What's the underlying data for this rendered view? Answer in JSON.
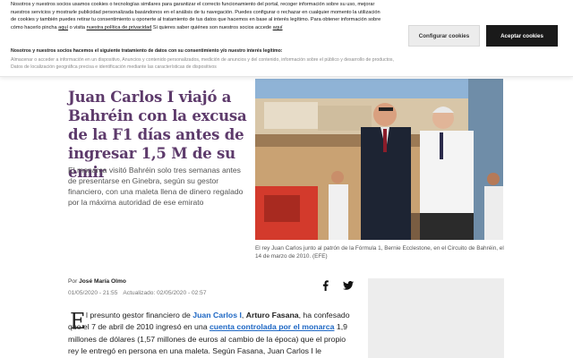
{
  "cookie": {
    "text_1": "Nosotros y nuestros socios usamos cookies o tecnologías similares para garantizar el correcto funcionamiento del portal, recoger información sobre su uso, mejorar nuestros servicios y mostrarle publicidad personalizada basándonos en el análisis de tu navegación. Puedes configurar o rechazar en cualquier momento la utilización de cookies y también puedes retirar tu consentimiento u oponerte al tratamiento de tus datos que hacemos en base al interés legítimo. Para obtener información sobre cómo hacerlo pincha ",
    "link_aqui_1": "aquí",
    "text_2": " o visita ",
    "link_policy": "nuestra política de privacidad",
    "text_3": " Si quieres saber quiénes son nuestros socios accede ",
    "link_aqui_2": "aquí",
    "legit_title": "Nosotros y nuestros socios hacemos el siguiente tratamiento de datos con su consentimiento y/o nuestro interés legítimo:",
    "legit_list": "Almacenar o acceder a información en un dispositivo, Anuncios y contenido personalizados, medición de anuncios y del contenido, información sobre el público y desarrollo de productos, Datos de localización geográfica precisa e identificación mediante las características de dispositivos",
    "config_label": "Configurar cookies",
    "accept_label": "Aceptar cookies"
  },
  "article": {
    "headline": "Juan Carlos I viajó a Bahréin con la excusa de la F1 días antes de ingresar 1,5 M de su emir",
    "summary": "El monarca visitó Bahréin solo tres semanas antes de presentarse en Ginebra, según su gestor financiero, con una maleta llena de dinero regalado por la máxima autoridad de ese emirato",
    "photo_caption": "El rey Juan Carlos junto al patrón de la Fórmula 1, Bernie Ecclestone, en el Circuito de Bahréin, el 14 de marzo de 2010. (EFE)",
    "byline_prefix": "Por",
    "author": "José María Olmo",
    "published": "01/05/2020 - 21:55",
    "updated": "Actualizado: 02/05/2020 - 02:57",
    "dropcap": "E",
    "body": {
      "t1": "l presunto gestor financiero de ",
      "link1": "Juan Carlos I",
      "t2": ", ",
      "bold1": "Arturo Fasana",
      "t3": ", ha confesado que el 7 de abril de 2010 ingresó en una ",
      "link2": "cuenta controlada por el monarca",
      "t4": " 1,9 millones de dólares (1,57 millones de euros al cambio de la época) que el propio rey le entregó en persona en una maleta. Según Fasana, Juan Carlos I le"
    }
  },
  "icons": {
    "share_fb": "facebook-icon",
    "share_tw": "twitter-icon"
  },
  "colors": {
    "headline": "#5d3a6b",
    "link": "#1f68c4",
    "accept_bg": "#1a1a1a",
    "config_bg": "#ececec"
  }
}
